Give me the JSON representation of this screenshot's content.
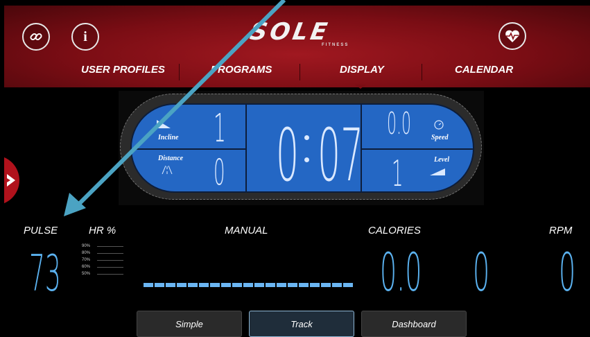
{
  "header": {
    "logo_text": "SOLE",
    "logo_sub": "FITNESS",
    "info_glyph": "i",
    "nav": [
      "USER PROFILES",
      "PROGRAMS",
      "DISPLAY",
      "CALENDAR"
    ],
    "accent_color": "#8b0f17"
  },
  "console": {
    "incline_label": "Incline",
    "incline_value": "1",
    "distance_label": "Distance",
    "distance_value": "0",
    "time_min": "0",
    "time_sec": "07",
    "speed_label": "Speed",
    "speed_value": "0.0",
    "level_label": "Level",
    "level_value": "1",
    "lcd_color": "#2467c4"
  },
  "stats": {
    "pulse_label": "PULSE",
    "pulse_value": "73",
    "hr_label": "HR %",
    "hr_scale": [
      "90%",
      "80%",
      "70%",
      "60%",
      "50%"
    ],
    "manual_label": "MANUAL",
    "calories_label": "CALORIES",
    "calories_value": "0.0",
    "middle_value": "0",
    "rpm_label": "RPM",
    "rpm_value": "0",
    "value_color": "#5bb2f0"
  },
  "tabs": [
    "Simple",
    "Track",
    "Dashboard"
  ],
  "active_tab": "Track",
  "icons": [
    "link-icon",
    "info-icon",
    "heart-rate-icon",
    "chevron-right-icon",
    "speed-gauge-icon",
    "incline-icon",
    "road-icon",
    "level-icon"
  ]
}
